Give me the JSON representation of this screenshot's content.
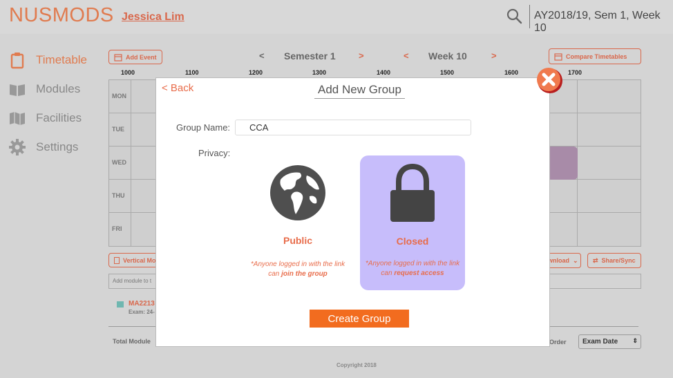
{
  "header": {
    "brand": "NUSMODS",
    "user": "Jessica Lim",
    "term": "AY2018/19, Sem 1, Week 10"
  },
  "sidebar": {
    "items": [
      {
        "label": "Timetable",
        "icon": "clipboard-icon",
        "active": true
      },
      {
        "label": "Modules",
        "icon": "book-icon"
      },
      {
        "label": "Facilities",
        "icon": "map-icon"
      },
      {
        "label": "Settings",
        "icon": "gear-icon"
      }
    ]
  },
  "toolbar": {
    "add_event": "Add Event",
    "semester": "Semester 1",
    "week": "Week 10",
    "prev": "<",
    "next": ">",
    "compare": "Compare Timetables"
  },
  "timetable": {
    "hours": [
      "1000",
      "1100",
      "1200",
      "1300",
      "1400",
      "1500",
      "1600",
      "1700"
    ],
    "days": [
      "MON",
      "TUE",
      "WED",
      "THU",
      "FRI"
    ]
  },
  "below": {
    "vertical_mode": "Vertical Mod",
    "download": "wnload",
    "share": "Share/Sync",
    "add_module_placeholder": "Add module to t",
    "module_code": "MA2213",
    "module_exam": "Exam: 24-",
    "total_modules": "Total Module",
    "order": "Order",
    "sort_select": "Exam Date",
    "copyright": "Copyright 2018"
  },
  "modal": {
    "back": "< Back",
    "title": "Add New Group",
    "group_name_label": "Group Name:",
    "group_name_value": "CCA",
    "privacy_label": "Privacy:",
    "public": {
      "label": "Public",
      "note_prefix": "*Anyone logged in with the link can ",
      "note_emphasis": "join the group"
    },
    "closed": {
      "label": "Closed",
      "note_prefix": "*Anyone logged in with the link can ",
      "note_emphasis": "request access",
      "selected": true
    },
    "create_button": "Create Group"
  },
  "colors": {
    "accent": "#e86c4a",
    "create_button": "#f26c1f",
    "selected_card": "#c7bdfb",
    "event_block": "#a88ba8"
  }
}
